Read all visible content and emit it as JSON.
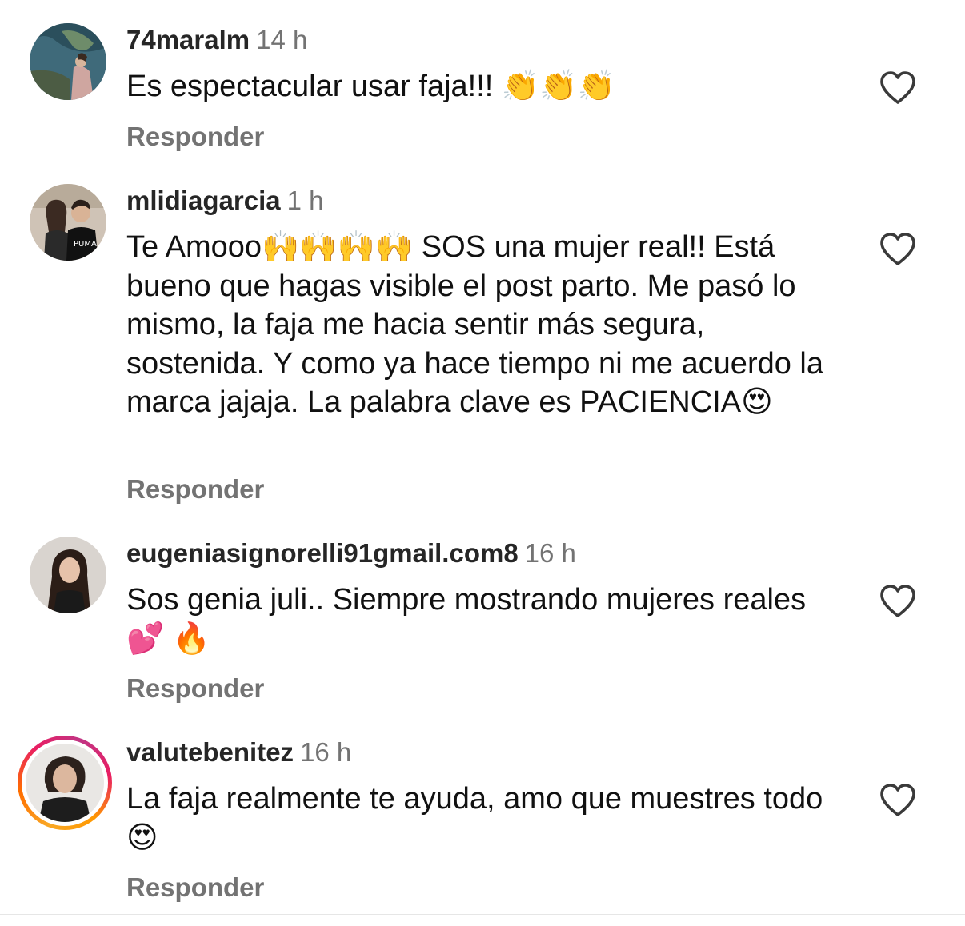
{
  "comments": [
    {
      "username": "74maralm",
      "time": "14 h",
      "text": "Es espectacular usar faja!!! 👏👏👏",
      "reply_label": "Responder",
      "has_story_ring": false
    },
    {
      "username": "mlidiagarcia",
      "time": "1 h",
      "text": "Te Amooo🙌🙌🙌🙌 SOS una mujer real!! Está bueno que hagas visible el post parto. Me pasó lo mismo, la faja me hacia sentir más segura, sostenida. Y como ya hace tiempo ni me acuerdo la marca jajaja. La palabra clave es PACIENCIA😍",
      "reply_label": "Responder",
      "has_story_ring": false
    },
    {
      "username": "eugeniasignorelli91gmail.com8",
      "time": "16 h",
      "text": "Sos genia juli.. Siempre mostrando mujeres reales💕 🔥",
      "reply_label": "Responder",
      "has_story_ring": false
    },
    {
      "username": "valutebenitez",
      "time": "16 h",
      "text": "La faja realmente te ayuda, amo que muestres todo 😍",
      "reply_label": "Responder",
      "has_story_ring": true
    }
  ],
  "icons": {
    "like": "heart-outline-icon"
  },
  "colors": {
    "username": "#262626",
    "secondary": "#737373",
    "text": "#111111",
    "story_ring": [
      "#f9a825",
      "#e91e63",
      "#c13584"
    ]
  }
}
